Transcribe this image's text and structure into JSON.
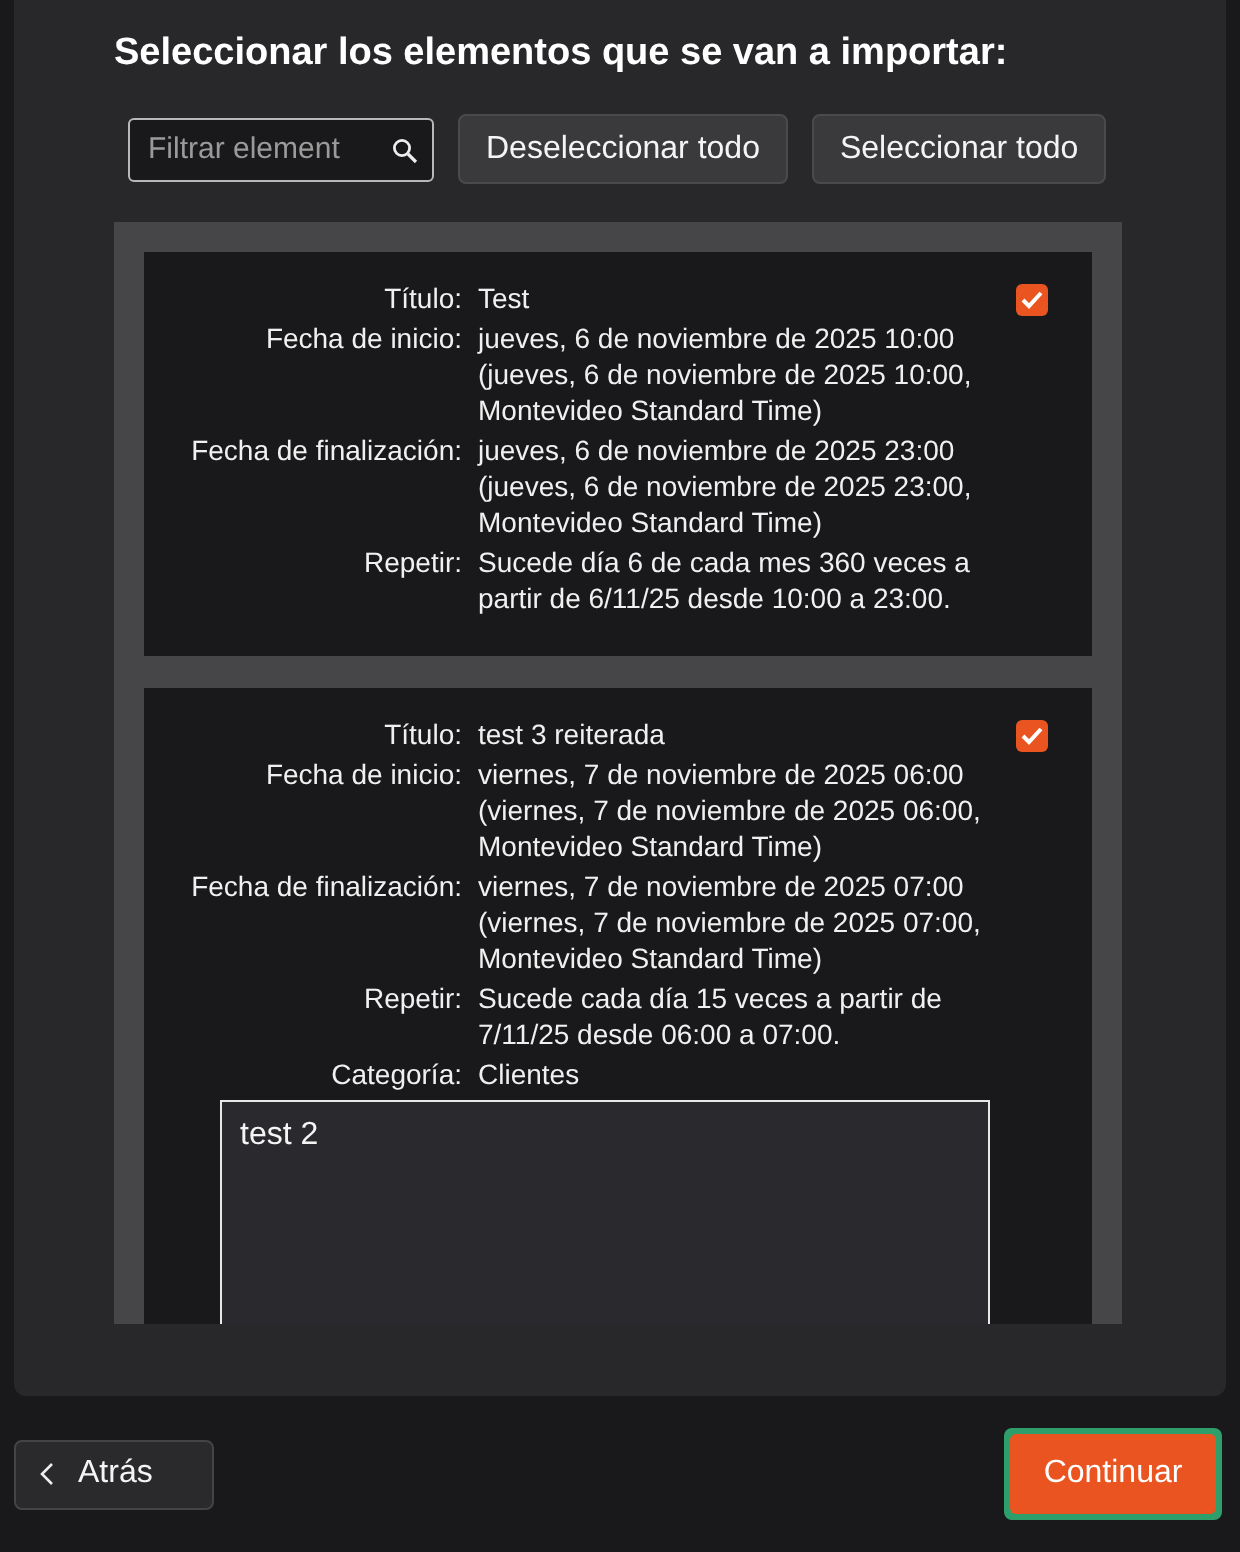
{
  "heading": "Seleccionar los elementos que se van a importar:",
  "filter": {
    "placeholder": "Filtrar element"
  },
  "toolbar_buttons": [
    "Deseleccionar todo",
    "Seleccionar todo"
  ],
  "items": [
    {
      "checked": true,
      "fields": [
        {
          "label": "Título:",
          "value": "Test"
        },
        {
          "label": "Fecha de inicio:",
          "value": "jueves, 6 de noviembre de 2025 10:00 (jueves, 6 de noviembre de 2025 10:00, Montevideo Standard Time)"
        },
        {
          "label": "Fecha de finalización:",
          "value": "jueves, 6 de noviembre de 2025 23:00 (jueves, 6 de noviembre de 2025 23:00, Montevideo Standard Time)"
        },
        {
          "label": "Repetir:",
          "value": "Sucede día 6 de cada mes 360 veces a partir de 6/11/25 desde 10:00 a 23:00."
        }
      ]
    },
    {
      "checked": true,
      "fields": [
        {
          "label": "Título:",
          "value": "test 3 reiterada"
        },
        {
          "label": "Fecha de inicio:",
          "value": "viernes, 7 de noviembre de 2025 06:00 (viernes, 7 de noviembre de 2025 06:00, Montevideo Standard Time)"
        },
        {
          "label": "Fecha de finalización:",
          "value": "viernes, 7 de noviembre de 2025 07:00 (viernes, 7 de noviembre de 2025 07:00, Montevideo Standard Time)"
        },
        {
          "label": "Repetir:",
          "value": "Sucede cada día 15 veces a partir de 7/11/25 desde 06:00 a 07:00."
        },
        {
          "label": "Categoría:",
          "value": "Clientes"
        }
      ],
      "notes": "test 2"
    }
  ],
  "back_button": "Atrás",
  "continue_button": "Continuar"
}
